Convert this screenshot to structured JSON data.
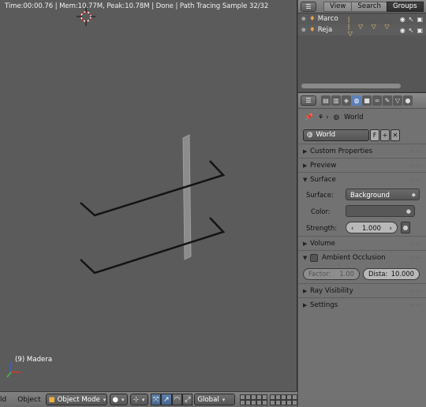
{
  "viewport": {
    "status": "Time:00:00.76 | Mem:10.77M, Peak:10.78M | Done | Path Tracing Sample 32/32",
    "object_label": "(9) Madera"
  },
  "viewport_header": {
    "menu_view": "ld",
    "menu_object": "Object",
    "mode": "Object Mode",
    "orientation": "Global"
  },
  "outliner": {
    "tabs": [
      "View",
      "Search",
      "Groups"
    ],
    "active_tab": "Groups",
    "rows": [
      {
        "name": "Marco",
        "mods": "|"
      },
      {
        "name": "Reja",
        "mods": "| ▽ ▽ ▽ ▽"
      }
    ]
  },
  "properties": {
    "breadcrumb": "World",
    "world_name": "World",
    "world_f": "F",
    "panels": {
      "custom_properties": "Custom Properties",
      "preview": "Preview",
      "surface": "Surface",
      "volume": "Volume",
      "ambient_occlusion": "Ambient Occlusion",
      "ray_visibility": "Ray Visibility",
      "settings": "Settings"
    },
    "surface": {
      "surface_label": "Surface:",
      "surface_value": "Background",
      "color_label": "Color:",
      "strength_label": "Strength:",
      "strength_value": "1.000"
    },
    "ao": {
      "factor_label": "Factor:",
      "factor_value": "1.00",
      "distance_label": "Dista:",
      "distance_value": "10.000"
    }
  },
  "colors": {
    "viewport_bg": "#5b5b5b",
    "accent_blue": "#5b80b8",
    "panel_bg": "#727272"
  }
}
